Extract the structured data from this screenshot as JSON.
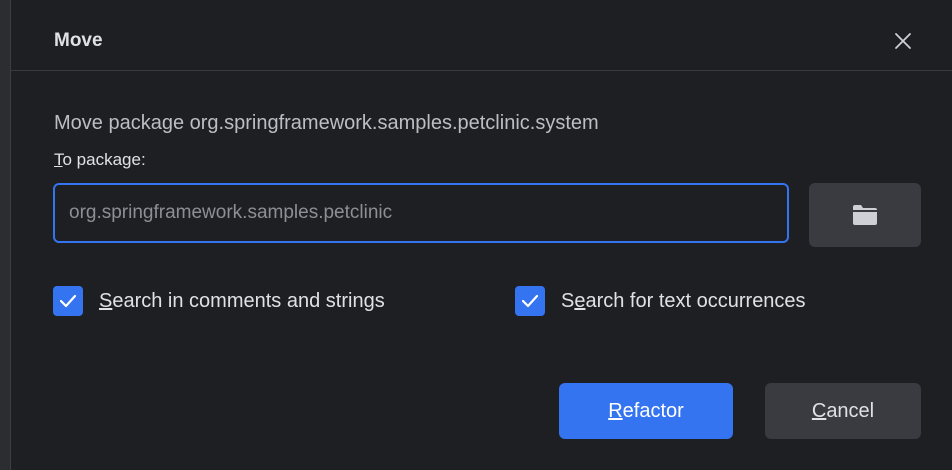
{
  "dialog": {
    "title": "Move",
    "description": "Move package org.springframework.samples.petclinic.system",
    "to_package": {
      "mnemonic": "T",
      "rest": "o package:"
    },
    "package_input": {
      "value": "",
      "placeholder": "org.springframework.samples.petclinic"
    },
    "options": [
      {
        "checked": true,
        "pre": "",
        "mnemonic": "S",
        "post": "earch in comments and strings"
      },
      {
        "checked": true,
        "pre": "S",
        "mnemonic": "e",
        "post": "arch for text occurrences"
      }
    ],
    "buttons": {
      "refactor": {
        "mnemonic": "R",
        "rest": "efactor"
      },
      "cancel": {
        "mnemonic": "C",
        "rest": "ancel"
      }
    }
  },
  "icons": {
    "close": "close-icon",
    "browse": "folder-icon",
    "check": "checkmark-icon"
  },
  "colors": {
    "background": "#1e1f22",
    "accent": "#3574f0",
    "secondary_button": "#393b40",
    "text": "#dfe1e5"
  }
}
